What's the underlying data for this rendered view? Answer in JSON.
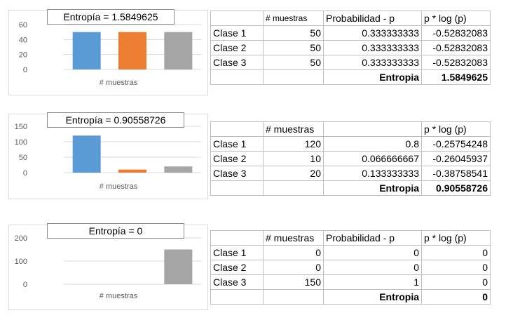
{
  "colors": {
    "blue": "#5b9bd5",
    "orange": "#ed7d31",
    "gray": "#a5a5a5",
    "grid": "#d9d9d9"
  },
  "chart_data": [
    {
      "type": "bar",
      "title": "Entropía = 1.5849625",
      "xlabel": "# muestras",
      "ylim": [
        0,
        60
      ],
      "yticks": [
        "0",
        "20",
        "40",
        "60"
      ],
      "series": [
        {
          "values": [
            50,
            50,
            50
          ]
        }
      ]
    },
    {
      "type": "bar",
      "title": "Entropía = 0.90558726",
      "xlabel": "# muestras",
      "ylim": [
        0,
        150
      ],
      "yticks": [
        "0",
        "50",
        "100",
        "150"
      ],
      "series": [
        {
          "values": [
            120,
            10,
            20
          ]
        }
      ]
    },
    {
      "type": "bar",
      "title": "Entropía = 0",
      "xlabel": "# muestras",
      "ylim": [
        0,
        200
      ],
      "yticks": [
        "0",
        "100",
        "200"
      ],
      "series": [
        {
          "values": [
            0,
            0,
            150
          ]
        }
      ]
    }
  ],
  "tables": [
    {
      "headers": [
        "",
        "# muestras",
        "Probabilidad - p",
        "p * log (p)"
      ],
      "rows": [
        [
          "Clase 1",
          "50",
          "0.333333333",
          "-0.52832083"
        ],
        [
          "Clase 2",
          "50",
          "0.333333333",
          "-0.52832083"
        ],
        [
          "Clase 3",
          "50",
          "0.333333333",
          "-0.52832083"
        ]
      ],
      "total_label": "Entropia",
      "total_value": "1.5849625"
    },
    {
      "headers": [
        "",
        "# muestras",
        "",
        "p * log (p)"
      ],
      "rows": [
        [
          "Clase 1",
          "120",
          "0.8",
          "-0.25754248"
        ],
        [
          "Clase 2",
          "10",
          "0.066666667",
          "-0.26045937"
        ],
        [
          "Clase 3",
          "20",
          "0.133333333",
          "-0.38758541"
        ]
      ],
      "total_label": "Entropia",
      "total_value": "0.90558726"
    },
    {
      "headers": [
        "",
        "# muestras",
        "Probabilidad - p",
        "p * log (p)"
      ],
      "rows": [
        [
          "Clase 1",
          "0",
          "0",
          "0"
        ],
        [
          "Clase 2",
          "0",
          "0",
          "0"
        ],
        [
          "Clase 3",
          "150",
          "1",
          "0"
        ]
      ],
      "total_label": "Entropia",
      "total_value": "0"
    }
  ]
}
